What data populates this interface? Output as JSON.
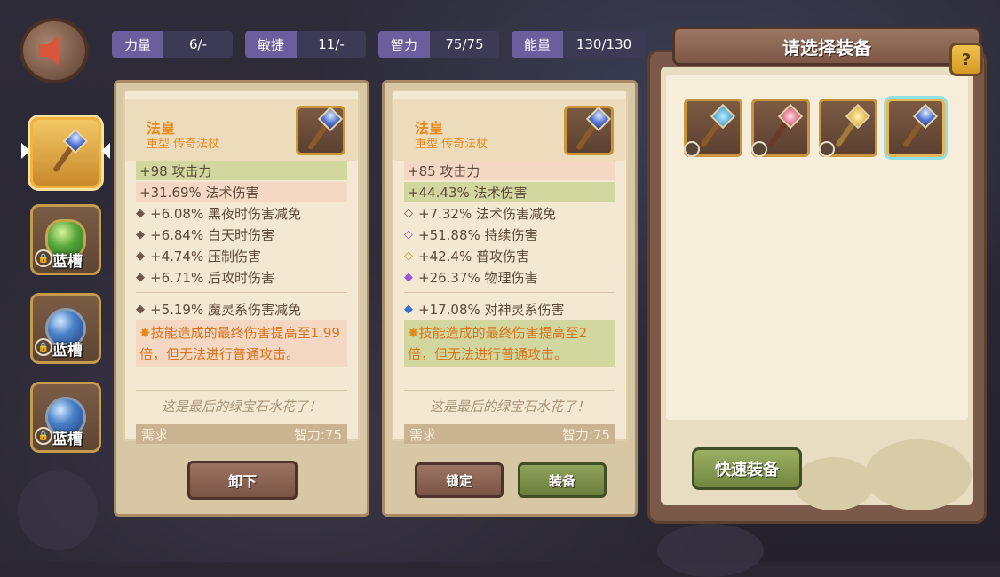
{
  "stats": [
    {
      "label": "力量",
      "value": "6/-"
    },
    {
      "label": "敏捷",
      "value": "11/-"
    },
    {
      "label": "智力",
      "value": "75/75"
    },
    {
      "label": "能量",
      "value": "130/130"
    }
  ],
  "slots": [
    {
      "type": "staff",
      "active": true,
      "label": ""
    },
    {
      "type": "green-gem",
      "locked": true,
      "label": "蓝槽"
    },
    {
      "type": "blue-gem",
      "locked": true,
      "label": "蓝槽"
    },
    {
      "type": "blue-gem",
      "locked": true,
      "label": "蓝槽"
    }
  ],
  "left_card": {
    "title": "法皇",
    "subtitle": "重型 传奇法杖",
    "main_stats": [
      "+98 攻击力",
      "+31.69% 法术伤害"
    ],
    "sub_stats": [
      "+6.08% 黑夜时伤害减免",
      "+6.84% 白天时伤害",
      "+4.74% 压制伤害",
      "+6.71% 后攻时伤害"
    ],
    "extra_stat": "+5.19% 魔灵系伤害减免",
    "skill": "技能造成的最终伤害提高至1.99倍，但无法进行普通攻击。",
    "quote": "这是最后的绿宝石水花了！",
    "req_label": "需求",
    "req_value": "智力:75",
    "button": "卸下"
  },
  "right_card": {
    "title": "法皇",
    "subtitle": "重型 传奇法杖",
    "main_stats": [
      "+85 攻击力",
      "+44.43% 法术伤害"
    ],
    "sub_stats": [
      "+7.32% 法术伤害减免",
      "+51.88% 持续伤害",
      "+42.4% 普攻伤害",
      "+26.37% 物理伤害"
    ],
    "extra_stat": "+17.08% 对神灵系伤害",
    "skill": "技能造成的最终伤害提高至2倍，但无法进行普通攻击。",
    "quote": "这是最后的绿宝石水花了！",
    "req_label": "需求",
    "req_value": "智力:75",
    "lock_button": "锁定",
    "equip_button": "装备"
  },
  "panel": {
    "title": "请选择装备",
    "help": "?",
    "quick_equip": "快速装备"
  },
  "colors": {
    "accent_orange": "#e6891d",
    "green_highlight": "#d2d69f",
    "pink_highlight": "#f5d8c3",
    "stat_label_bg": "#6a5f9c"
  }
}
